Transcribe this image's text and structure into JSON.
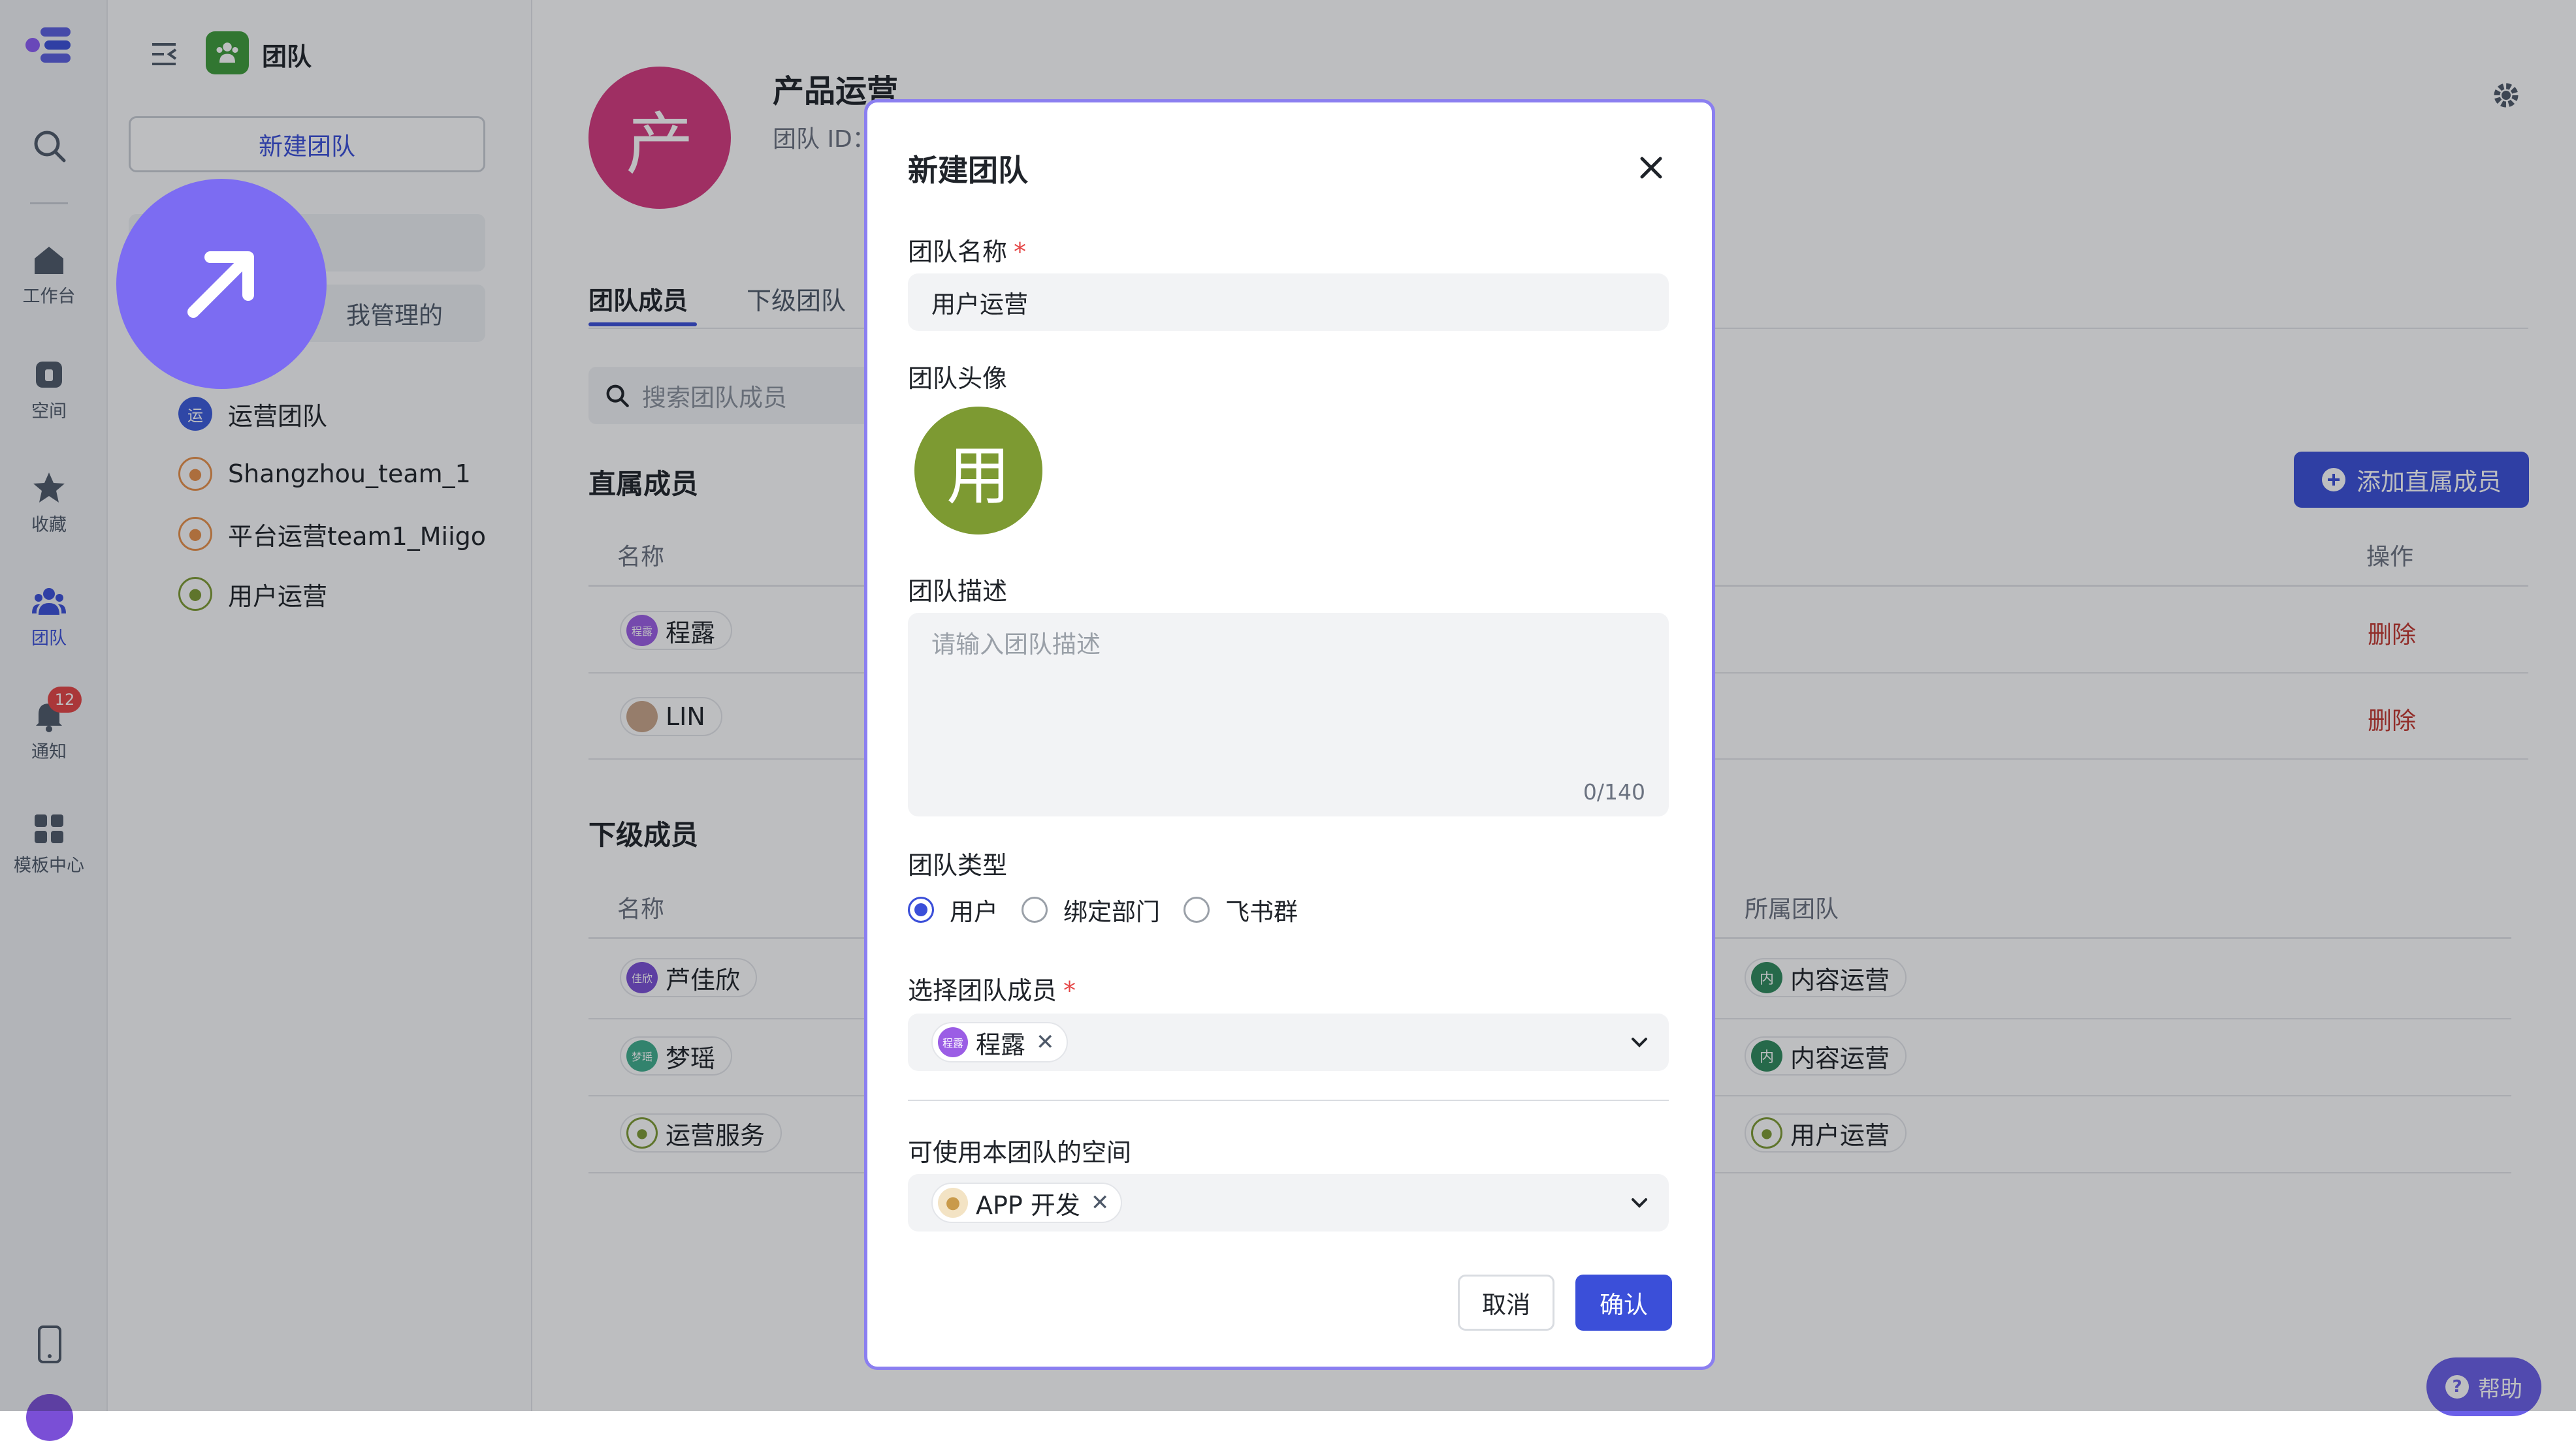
{
  "rail": {
    "items": [
      {
        "label": "工作台",
        "icon": "home-icon"
      },
      {
        "label": "空间",
        "icon": "space-icon"
      },
      {
        "label": "收藏",
        "icon": "star-icon"
      },
      {
        "label": "团队",
        "icon": "team-icon"
      },
      {
        "label": "通知",
        "icon": "bell-icon"
      },
      {
        "label": "模板中心",
        "icon": "template-icon"
      }
    ],
    "notification_count": "12",
    "active_color": "#3b4fd9"
  },
  "sidebar": {
    "title": "团队",
    "new_team_button": "新建团队",
    "tab_managed": "我管理的",
    "teams": [
      {
        "icon_text": "运",
        "name": "运营团队"
      },
      {
        "icon_text": "",
        "name": "Shangzhou_team_1"
      },
      {
        "icon_text": "",
        "name": "平台运营team1_Miigo"
      },
      {
        "icon_text": "",
        "name": "用户运营"
      }
    ]
  },
  "main": {
    "team_avatar_char": "产",
    "team_name": "产品运营",
    "team_id_label": "团队 ID：",
    "tabs": [
      "团队成员",
      "下级团队"
    ],
    "search_placeholder": "搜索团队成员",
    "add_direct_member_button": "添加直属成员",
    "direct_members_title": "直属成员",
    "col_name": "名称",
    "col_action": "操作",
    "direct_members": [
      {
        "avatar_text": "程露",
        "name": "程露",
        "action": "删除"
      },
      {
        "avatar_text": "",
        "name": "LIN",
        "action": "删除"
      }
    ],
    "sub_members_title": "下级成员",
    "col_team": "所属团队",
    "sub_members": [
      {
        "avatar_text": "佳欣",
        "name": "芦佳欣",
        "team_icon": "内",
        "team": "内容运营"
      },
      {
        "avatar_text": "梦瑶",
        "name": "梦瑶",
        "team_icon": "内",
        "team": "内容运营"
      },
      {
        "avatar_text": "",
        "name": "运营服务",
        "team_icon": "",
        "team": "用户运营"
      }
    ],
    "help_button": "帮助"
  },
  "modal": {
    "title": "新建团队",
    "name_label": "团队名称",
    "required_mark": "*",
    "name_value": "用户运营",
    "avatar_label": "团队头像",
    "avatar_char": "用",
    "avatar_color": "#7d9a32",
    "desc_label": "团队描述",
    "desc_placeholder": "请输入团队描述",
    "desc_counter": "0/140",
    "type_label": "团队类型",
    "type_options": [
      "用户",
      "绑定部门",
      "飞书群"
    ],
    "type_selected": "用户",
    "members_label": "选择团队成员",
    "members_selected": [
      {
        "avatar_text": "程露",
        "name": "程露"
      }
    ],
    "spaces_label": "可使用本团队的空间",
    "spaces_selected": [
      {
        "name": "APP 开发"
      }
    ],
    "cancel_button": "取消",
    "confirm_button": "确认",
    "accent_color": "#3b4fd9"
  },
  "cursor_icon": "arrow-cursor-icon"
}
